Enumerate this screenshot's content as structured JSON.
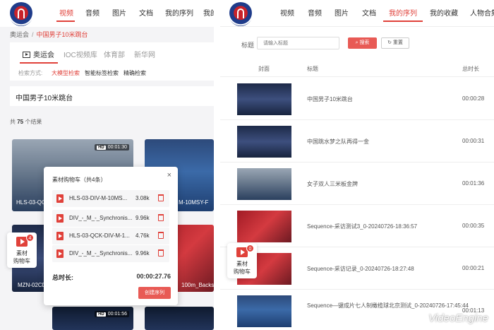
{
  "left": {
    "nav": [
      "视频",
      "音频",
      "图片",
      "文档",
      "我的序列",
      "我的"
    ],
    "breadcrumb": {
      "root": "奥运会",
      "current": "中国男子10米跳台"
    },
    "tabs": [
      "奥运会",
      "IOC视频库",
      "体育部",
      "新华网"
    ],
    "search_mode": {
      "label": "检索方式:",
      "options": [
        "大模型检索",
        "智能标签检索",
        "精确检索"
      ]
    },
    "query": "中国男子10米跳台",
    "result_count": {
      "prefix": "共",
      "num": "75",
      "suffix": "个结果"
    },
    "cards": [
      {
        "title": "HLS-03-QC",
        "duration": "00:01:30",
        "hd": "HD"
      },
      {
        "title": "M-10MSY-F",
        "duration": "",
        "hd": ""
      },
      {
        "title": "MZN-02CD",
        "duration": "",
        "hd": ""
      },
      {
        "title": "100m_Backst",
        "duration": "",
        "hd": ""
      },
      {
        "title": "",
        "duration": "00:01:56",
        "hd": "HD"
      },
      {
        "title": "",
        "duration": "",
        "hd": ""
      }
    ],
    "cart_popup": {
      "title": "素材购物车（共4条）",
      "close": "×",
      "items": [
        {
          "name": "HLS-03-DIV-M-10MS...",
          "size": "3.08k"
        },
        {
          "name": "DIV_-_M_-_Synchronis...",
          "size": "9.96k"
        },
        {
          "name": "HLS-03-QCK-DIV-M-1...",
          "size": "4.76k"
        },
        {
          "name": "DIV_-_M_-_Synchronis...",
          "size": "9.96k"
        }
      ],
      "total_label": "总时长:",
      "total_value": "00:00:27.76",
      "create_button": "创建序列"
    },
    "cart_float": {
      "badge": "4",
      "label_line1": "素材",
      "label_line2": "购物车"
    }
  },
  "right": {
    "nav": [
      "视频",
      "音频",
      "图片",
      "文档",
      "我的序列",
      "我的收藏",
      "人物合集"
    ],
    "search": {
      "label": "标题",
      "placeholder": "请输入标题",
      "search_button": "搜索",
      "reset_button": "重置"
    },
    "columns": {
      "cover": "封面",
      "title": "标题",
      "duration": "总时长"
    },
    "rows": [
      {
        "title": "中国男子10米跳台",
        "duration": "00:00:28"
      },
      {
        "title": "中国跳水梦之队再得一金",
        "duration": "00:00:31"
      },
      {
        "title": "女子双人三米板金牌",
        "duration": "00:01:36"
      },
      {
        "title": "Sequence-采访测试3_0-20240726-18:36:57",
        "duration": "00:00:35"
      },
      {
        "title": "Sequence-采访记录_0-20240726-18:27:48",
        "duration": "00:00:21"
      },
      {
        "title": "Sequence—键成片七人制橄榄球北京测试_0-20240726-17:45:44",
        "duration": "00:01:13"
      }
    ],
    "cart_float": {
      "badge": "0",
      "label_line1": "素材",
      "label_line2": "购物车"
    }
  },
  "watermark": "VideoEngine",
  "colors": {
    "accent": "#e0413a",
    "button": "#e85a55",
    "logo_blue": "#1f3c8a"
  }
}
